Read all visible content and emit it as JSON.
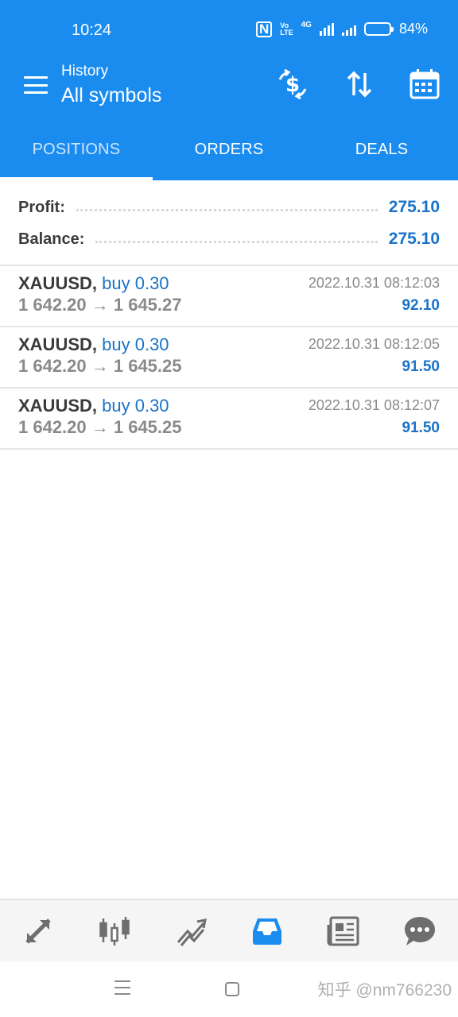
{
  "status_bar": {
    "time": "10:24",
    "icons": [
      "nfc-icon",
      "volte-icon",
      "signal-icon",
      "battery-icon"
    ],
    "network": "4G",
    "battery": "84%",
    "battery_level": 0.84
  },
  "toolbar": {
    "subtitle": "History",
    "title": "All symbols",
    "actions": [
      "currency-exchange-icon",
      "sort-icon",
      "calendar-icon"
    ]
  },
  "tabs": [
    {
      "label": "POSITIONS",
      "active": true
    },
    {
      "label": "ORDERS",
      "active": false
    },
    {
      "label": "DEALS",
      "active": false
    }
  ],
  "summary": {
    "profit_label": "Profit:",
    "profit_value": "275.10",
    "balance_label": "Balance:",
    "balance_value": "275.10"
  },
  "deals": [
    {
      "symbol": "XAUUSD,",
      "side": "buy 0.30",
      "prices": "1 642.20 → 1 645.27",
      "time": "2022.10.31 08:12:03",
      "profit": "92.10"
    },
    {
      "symbol": "XAUUSD,",
      "side": "buy 0.30",
      "prices": "1 642.20 → 1 645.25",
      "time": "2022.10.31 08:12:05",
      "profit": "91.50"
    },
    {
      "symbol": "XAUUSD,",
      "side": "buy 0.30",
      "prices": "1 642.20 → 1 645.25",
      "time": "2022.10.31 08:12:07",
      "profit": "91.50"
    }
  ],
  "bottom_nav": [
    {
      "icon": "quotes-arrows-icon",
      "active": false
    },
    {
      "icon": "candlestick-chart-icon",
      "active": false
    },
    {
      "icon": "trade-chart-icon",
      "active": false
    },
    {
      "icon": "history-inbox-icon",
      "active": true
    },
    {
      "icon": "news-icon",
      "active": false
    },
    {
      "icon": "chat-icon",
      "active": false
    }
  ],
  "watermark": "知乎 @nm766230",
  "colors": {
    "primary": "#1a8cf0",
    "accent_text": "#1a73c9",
    "muted_text": "#8a8a8a",
    "nav_active": "#1a8cf0",
    "nav_inactive": "#6e6e6e"
  }
}
